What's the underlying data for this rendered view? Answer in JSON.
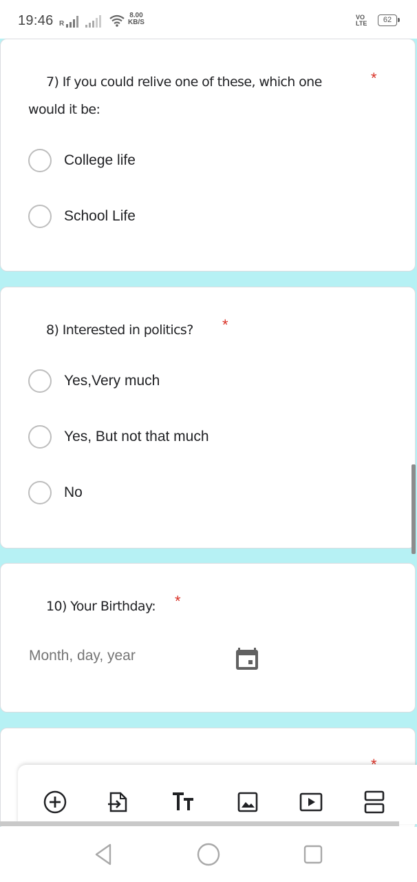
{
  "status_bar": {
    "time": "19:46",
    "network_speed_value": "8.00",
    "network_speed_unit": "KB/S",
    "volte_top": "VO",
    "volte_bottom": "LTE",
    "battery": "62"
  },
  "questions": [
    {
      "number_text": "7) If you could relive one of these, which one",
      "number_text_line2": "would it be:",
      "required_mark": "*",
      "options": [
        "College life",
        "School Life"
      ]
    },
    {
      "number_text": "8) Interested in politics?",
      "required_mark": "*",
      "options": [
        "Yes,Very much",
        "Yes, But not that much",
        "No"
      ]
    },
    {
      "number_text": "10) Your Birthday:",
      "required_mark": "*",
      "date_placeholder": "Month, day, year",
      "icon": "calendar-icon"
    }
  ],
  "next_card_peek": {
    "required_mark": "*"
  },
  "toolbar": {
    "icons": [
      "add-question-icon",
      "import-questions-icon",
      "title-description-icon",
      "image-icon",
      "video-icon",
      "section-icon"
    ]
  },
  "nav_bar": {
    "icons": [
      "back-icon",
      "home-icon",
      "recents-icon"
    ]
  },
  "colors": {
    "background": "#b6f1f4",
    "required": "#d93025",
    "radio_border": "#bdbdbd"
  }
}
